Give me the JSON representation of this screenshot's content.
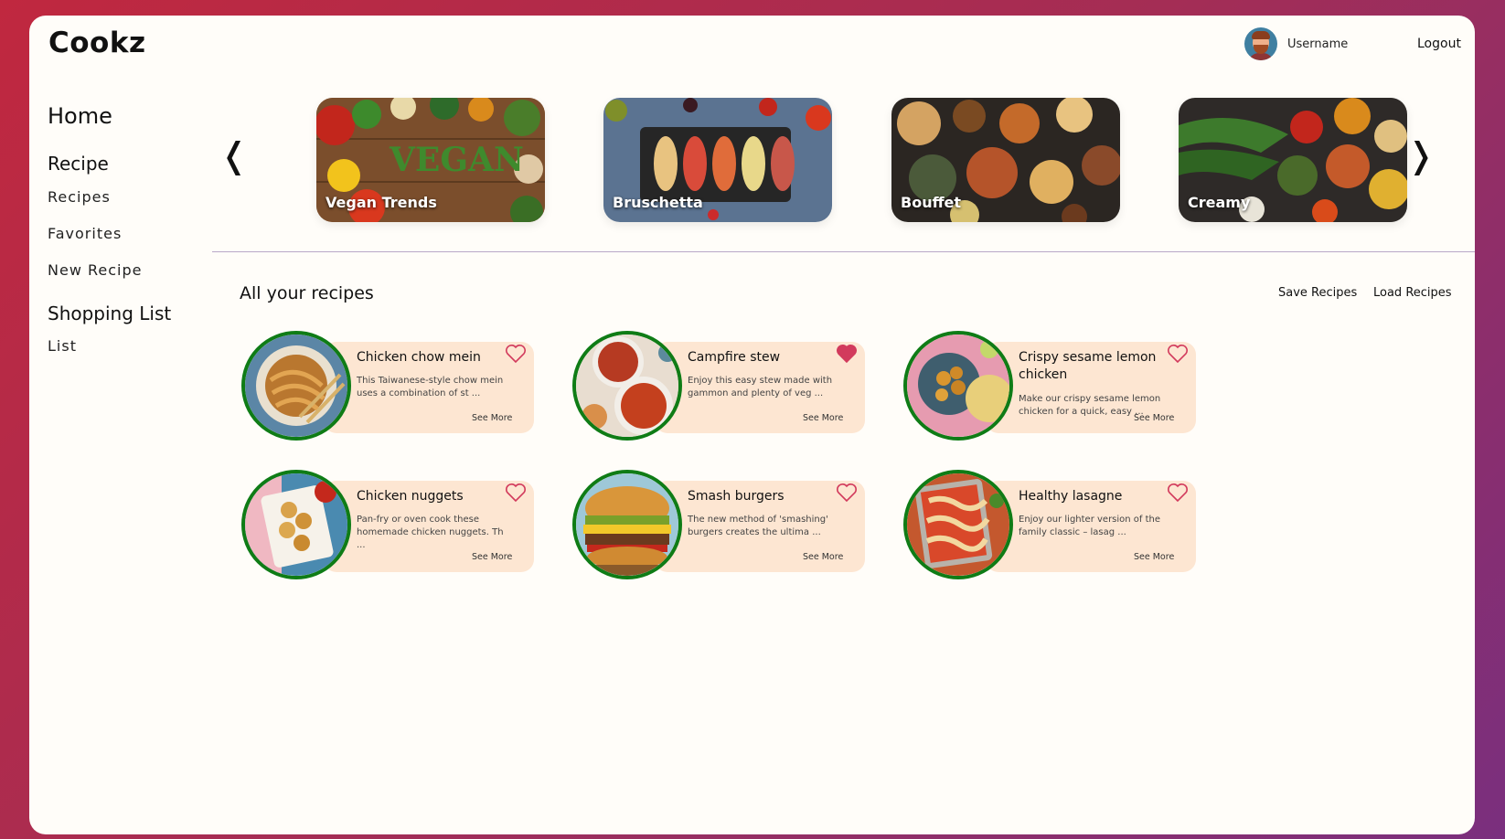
{
  "app": {
    "logo": "Cookz"
  },
  "header": {
    "username": "Username",
    "logout": "Logout"
  },
  "sidebar": {
    "home": "Home",
    "recipe_heading": "Recipe",
    "recipe_items": [
      "Recipes",
      "Favorites",
      "New Recipe"
    ],
    "shopping_heading": "Shopping List",
    "shopping_items": [
      "List"
    ]
  },
  "carousel": {
    "prev": "❬",
    "next": "❭",
    "cards": [
      {
        "label": "Vegan Trends"
      },
      {
        "label": "Bruschetta"
      },
      {
        "label": "Bouffet"
      },
      {
        "label": "Creamy"
      }
    ]
  },
  "recipes_section": {
    "title": "All your recipes",
    "save": "Save Recipes",
    "load": "Load Recipes"
  },
  "recipes": [
    {
      "name": "Chicken chow mein",
      "desc": "This Taiwanese-style chow mein uses a combination of st ...",
      "favorite": false
    },
    {
      "name": "Campfire stew",
      "desc": "Enjoy this easy stew made with gammon and plenty of veg ...",
      "favorite": true
    },
    {
      "name": "Crispy sesame lemon chicken",
      "desc": "Make our crispy sesame lemon chicken for a quick, easy ...",
      "favorite": false
    },
    {
      "name": "Chicken nuggets",
      "desc": "Pan-fry or oven cook these homemade chicken nuggets. Th ...",
      "favorite": false
    },
    {
      "name": "Smash burgers",
      "desc": "The new method of 'smashing' burgers creates the ultima ...",
      "favorite": false
    },
    {
      "name": "Healthy lasagne",
      "desc": "Enjoy our lighter version of the family classic – lasag ...",
      "favorite": false
    }
  ],
  "see_more": "See More",
  "colors": {
    "accent_ring": "#0f7c16",
    "card_bg": "#fde6d2",
    "heart": "#d23a5c"
  }
}
